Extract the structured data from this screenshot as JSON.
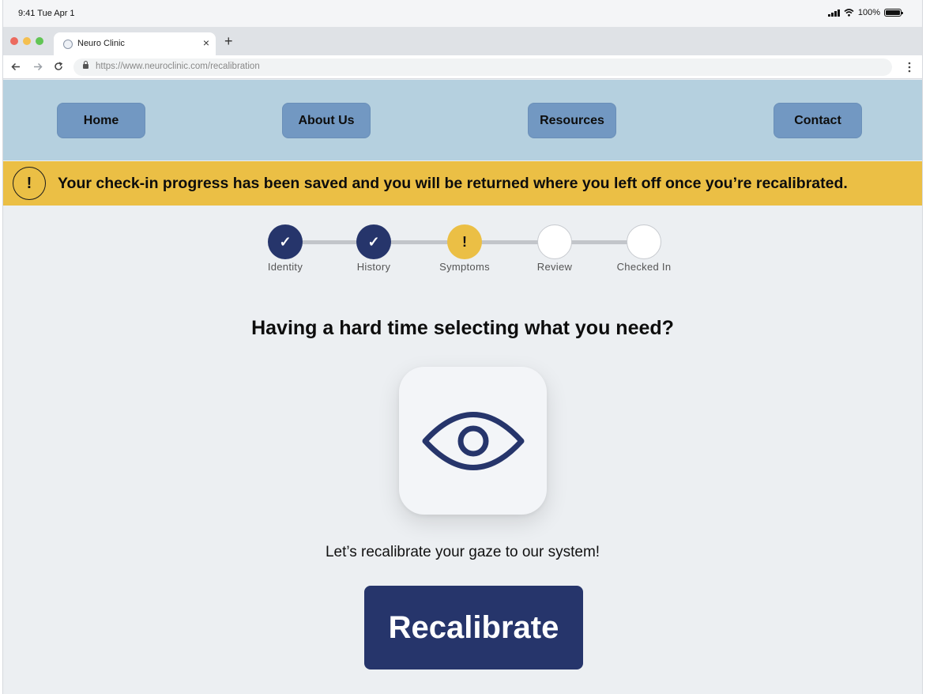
{
  "status_bar": {
    "time": "9:41  Tue Apr 1",
    "battery": "100%"
  },
  "browser": {
    "tab_title": "Neuro Clinic",
    "tab_close": "×",
    "new_tab": "+",
    "url": "https://www.neuroclinic.com/recalibration",
    "window_dots": [
      "#ec6a5e",
      "#f4bf4f",
      "#61c554"
    ]
  },
  "nav": {
    "items": [
      {
        "label": "Home"
      },
      {
        "label": "About Us"
      },
      {
        "label": "Resources"
      },
      {
        "label": "Contact"
      }
    ]
  },
  "banner": {
    "icon": "!",
    "message": "Your check-in progress has been saved and you will be returned where you left off once you’re recalibrated."
  },
  "stepper": {
    "steps": [
      {
        "label": "Identity",
        "state": "done",
        "glyph": "✓"
      },
      {
        "label": "History",
        "state": "done",
        "glyph": "✓"
      },
      {
        "label": "Symptoms",
        "state": "warning",
        "glyph": "!"
      },
      {
        "label": "Review",
        "state": "todo",
        "glyph": ""
      },
      {
        "label": "Checked In",
        "state": "todo",
        "glyph": ""
      }
    ]
  },
  "main": {
    "heading": "Having a hard time selecting what you need?",
    "icon": "eye-icon",
    "subtext": "Let’s recalibrate your gaze to our system!",
    "button_label": "Recalibrate"
  },
  "colors": {
    "accent": "#26356b",
    "warning": "#ebbf45",
    "header_bg": "#b5d0df",
    "nav_button": "#7298c2"
  }
}
